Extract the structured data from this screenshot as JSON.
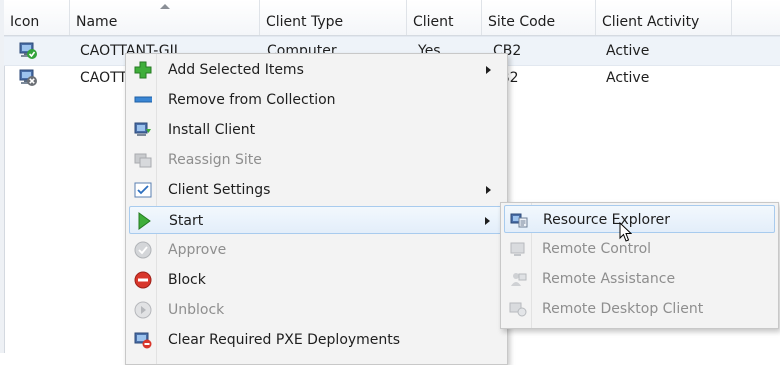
{
  "columns": [
    {
      "label": "Icon"
    },
    {
      "label": "Name"
    },
    {
      "label": "Client Type"
    },
    {
      "label": "Client"
    },
    {
      "label": "Site Code"
    },
    {
      "label": "Client Activity"
    }
  ],
  "rows": [
    {
      "name": "CAOTTANT-GII",
      "client_type": "Computer",
      "client": "Yes",
      "site_code": "CB2",
      "activity": "Active",
      "icon": "computer-check-icon"
    },
    {
      "name": "CAOTT",
      "client_type": "",
      "client": "",
      "site_code": "B2",
      "activity": "Active",
      "icon": "computer-x-icon"
    }
  ],
  "context_menu": {
    "items": [
      {
        "label": "Add Selected Items",
        "icon": "green-plus-icon",
        "enabled": true,
        "submenu": true
      },
      {
        "label": "Remove from Collection",
        "icon": "blue-minus-icon",
        "enabled": true,
        "submenu": false
      },
      {
        "label": "Install Client",
        "icon": "install-client-icon",
        "enabled": true,
        "submenu": false
      },
      {
        "label": "Reassign Site",
        "icon": "reassign-site-icon",
        "enabled": false,
        "submenu": false
      },
      {
        "label": "Client Settings",
        "icon": "client-settings-icon",
        "enabled": true,
        "submenu": true
      },
      {
        "label": "Start",
        "icon": "green-play-icon",
        "enabled": true,
        "submenu": true,
        "highlighted": true
      },
      {
        "label": "Approve",
        "icon": "approve-check-icon",
        "enabled": false,
        "submenu": false
      },
      {
        "label": "Block",
        "icon": "block-icon",
        "enabled": true,
        "submenu": false
      },
      {
        "label": "Unblock",
        "icon": "unblock-icon",
        "enabled": false,
        "submenu": false
      },
      {
        "label": "Clear Required PXE Deployments",
        "icon": "pxe-icon",
        "enabled": true,
        "submenu": false
      }
    ]
  },
  "start_submenu": {
    "items": [
      {
        "label": "Resource Explorer",
        "icon": "resource-explorer-icon",
        "enabled": true,
        "highlighted": true
      },
      {
        "label": "Remote Control",
        "icon": "remote-control-icon",
        "enabled": false
      },
      {
        "label": "Remote Assistance",
        "icon": "remote-assistance-icon",
        "enabled": false
      },
      {
        "label": "Remote Desktop Client",
        "icon": "remote-desktop-icon",
        "enabled": false
      }
    ]
  },
  "colors": {
    "menu_bg": "#f3f3f3",
    "highlight_border": "#a8cbee",
    "disabled_text": "#8e8e8e"
  }
}
